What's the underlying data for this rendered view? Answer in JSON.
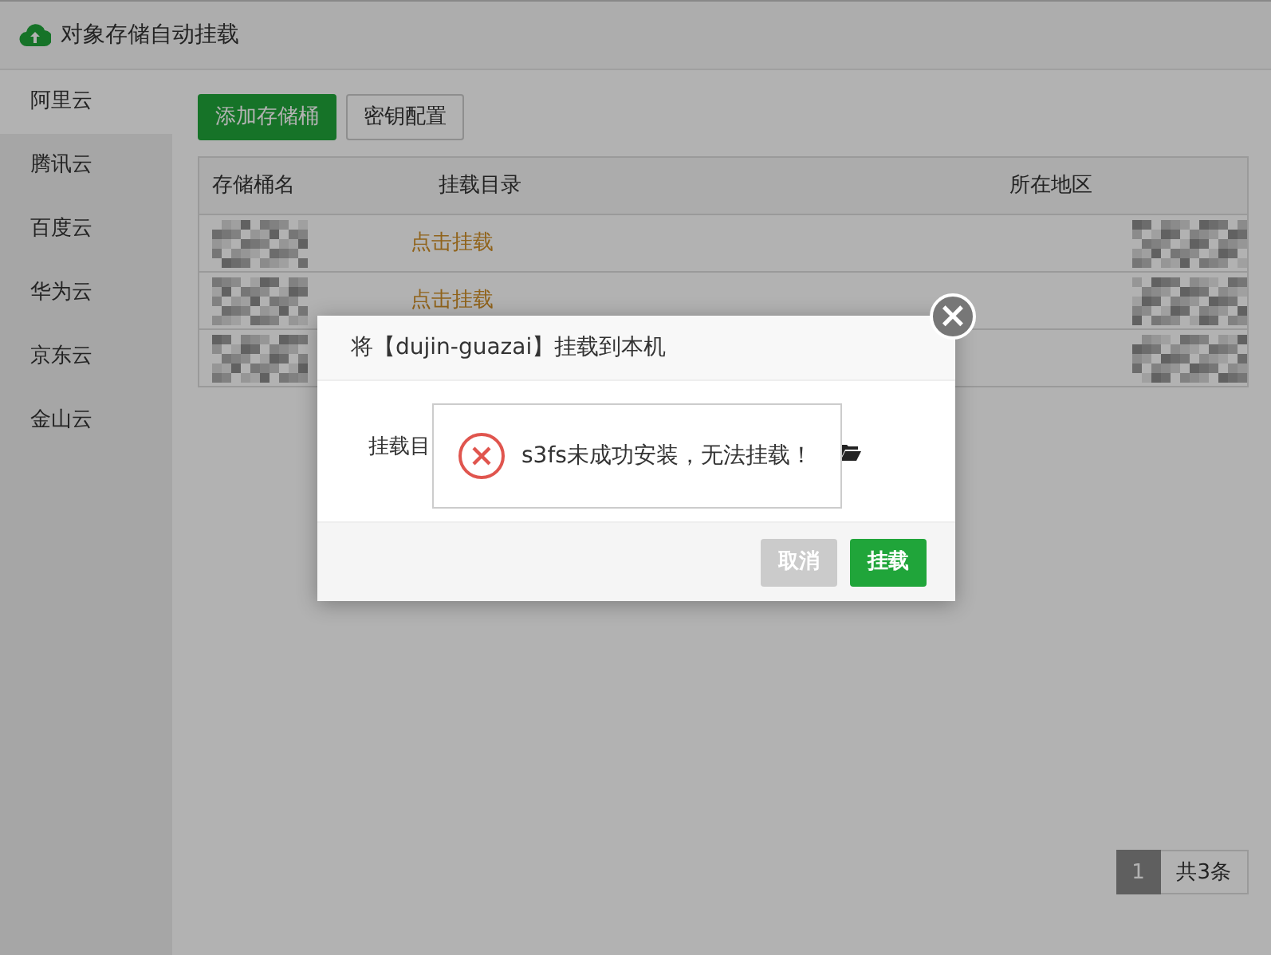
{
  "window": {
    "title": "对象存储自动挂载"
  },
  "sidebar": {
    "items": [
      {
        "label": "阿里云",
        "selected": true
      },
      {
        "label": "腾讯云",
        "selected": false
      },
      {
        "label": "百度云",
        "selected": false
      },
      {
        "label": "华为云",
        "selected": false
      },
      {
        "label": "京东云",
        "selected": false
      },
      {
        "label": "金山云",
        "selected": false
      }
    ]
  },
  "toolbar": {
    "buttons": [
      {
        "label": "添加存储桶",
        "kind": "primary"
      },
      {
        "label": "密钥配置",
        "kind": "default"
      }
    ]
  },
  "table": {
    "columns": [
      "存储桶名",
      "挂载目录",
      "所在地区"
    ],
    "rows": [
      {
        "name_redacted": true,
        "mount_link": "点击挂载",
        "region_redacted": true
      },
      {
        "name_redacted": true,
        "mount_link": "点击挂载",
        "region_redacted": true
      },
      {
        "name_redacted": true,
        "region_redacted": true
      }
    ]
  },
  "pagination": {
    "pages": [
      {
        "label": "1",
        "selected": true
      }
    ],
    "total": "共3条"
  },
  "dialog": {
    "title": "将【dujin-guazai】挂载到本机",
    "field_label": "挂载目",
    "buttons": [
      {
        "label": "取消",
        "kind": "cancel"
      },
      {
        "label": "挂载",
        "kind": "confirm"
      }
    ],
    "close": "×"
  },
  "toast": {
    "kind": "error",
    "message": "s3fs未成功安装，无法挂载！"
  }
}
